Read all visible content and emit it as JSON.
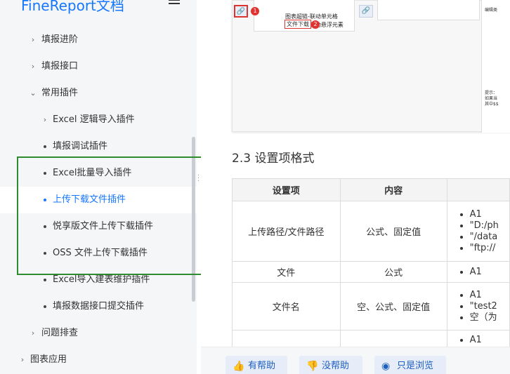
{
  "brand": {
    "title": "FineReport文档"
  },
  "sidebar": {
    "items": [
      {
        "label": "填报进阶",
        "level": 1,
        "marker": "chevron-right"
      },
      {
        "label": "填报接口",
        "level": 1,
        "marker": "chevron-right"
      },
      {
        "label": "常用插件",
        "level": 1,
        "marker": "chevron-down"
      },
      {
        "label": "Excel 逻辑导入插件",
        "level": 2,
        "marker": "chevron-right"
      },
      {
        "label": "填报调试插件",
        "level": 2,
        "marker": "bullet"
      },
      {
        "label": "Excel批量导入插件",
        "level": 2,
        "marker": "bullet"
      },
      {
        "label": "上传下载文件插件",
        "level": 2,
        "marker": "bullet",
        "active": true
      },
      {
        "label": "悦享版文件上传下载插件",
        "level": 2,
        "marker": "bullet"
      },
      {
        "label": "OSS 文件上传下载插件",
        "level": 2,
        "marker": "bullet"
      },
      {
        "label": "Excel导入建表维护插件",
        "level": 2,
        "marker": "bullet"
      },
      {
        "label": "填报数据接口提交插件",
        "level": 2,
        "marker": "bullet"
      },
      {
        "label": "问题排查",
        "level": 1,
        "marker": "chevron-right"
      },
      {
        "label": "图表应用",
        "level": 0,
        "marker": "chevron-right"
      }
    ]
  },
  "screenshot": {
    "menu_rows": [
      "图表超链-联动单元格",
      "图表超链-联动悬浮元素"
    ],
    "file_download": "文件下载",
    "badge_1": "1",
    "badge_2": "2",
    "right_label": "编辑类",
    "tip_line1": "提示：",
    "tip_line2": "如果当",
    "tip_line3": "其中$$"
  },
  "section": {
    "heading": "2.3 设置项格式"
  },
  "table": {
    "headers": [
      "设置项",
      "内容",
      ""
    ],
    "rows": [
      {
        "item": "上传路径/文件路径",
        "content": "公式、固定值",
        "values": [
          "A1",
          "\"D:/ph",
          "\"/data",
          "\"ftp://"
        ]
      },
      {
        "item": "文件",
        "content": "公式",
        "values": [
          "A1"
        ]
      },
      {
        "item": "文件名",
        "content": "空、公式、固定值",
        "values": [
          "A1",
          "\"test2",
          "空（为"
        ]
      },
      {
        "item": "",
        "content": "",
        "values": [
          "A1"
        ]
      }
    ]
  },
  "feedback": {
    "helpful": "有帮助",
    "not_helpful": "没帮助",
    "just_browsing": "只是浏览"
  },
  "colors": {
    "accent": "#1677ff",
    "highlight_box": "#2e8b2e",
    "marker_red": "#e0322e"
  }
}
